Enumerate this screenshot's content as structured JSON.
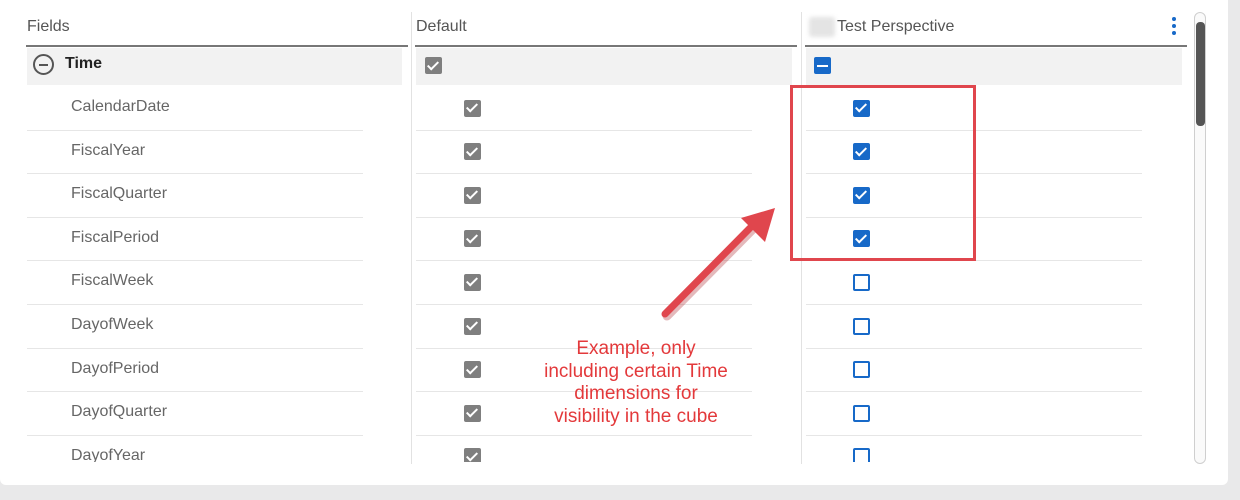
{
  "columns": {
    "fields": "Fields",
    "default": "Default",
    "perspective": "Test Perspective",
    "menu_icon": "kebab-menu-icon"
  },
  "group": {
    "label": "Time",
    "toggle_icon": "collapse-minus-icon",
    "default_state": "checked",
    "perspective_state": "indeterminate"
  },
  "rows": [
    {
      "label": "CalendarDate",
      "default": "checked",
      "perspective": "checked"
    },
    {
      "label": "FiscalYear",
      "default": "checked",
      "perspective": "checked"
    },
    {
      "label": "FiscalQuarter",
      "default": "checked",
      "perspective": "checked"
    },
    {
      "label": "FiscalPeriod",
      "default": "checked",
      "perspective": "checked"
    },
    {
      "label": "FiscalWeek",
      "default": "checked",
      "perspective": "unchecked"
    },
    {
      "label": "DayofWeek",
      "default": "checked",
      "perspective": "unchecked"
    },
    {
      "label": "DayofPeriod",
      "default": "checked",
      "perspective": "unchecked"
    },
    {
      "label": "DayofQuarter",
      "default": "checked",
      "perspective": "unchecked"
    },
    {
      "label": "DayofYear",
      "default": "checked",
      "perspective": "unchecked"
    }
  ],
  "annotation": {
    "lines": [
      "Example, only",
      "including certain Time",
      "dimensions for",
      "visibility in the cube"
    ],
    "color": "#e3393b"
  },
  "colors": {
    "accent": "#1769c8",
    "default_checkbox": "#7f7f7f",
    "annotation_red": "#e0464d"
  }
}
